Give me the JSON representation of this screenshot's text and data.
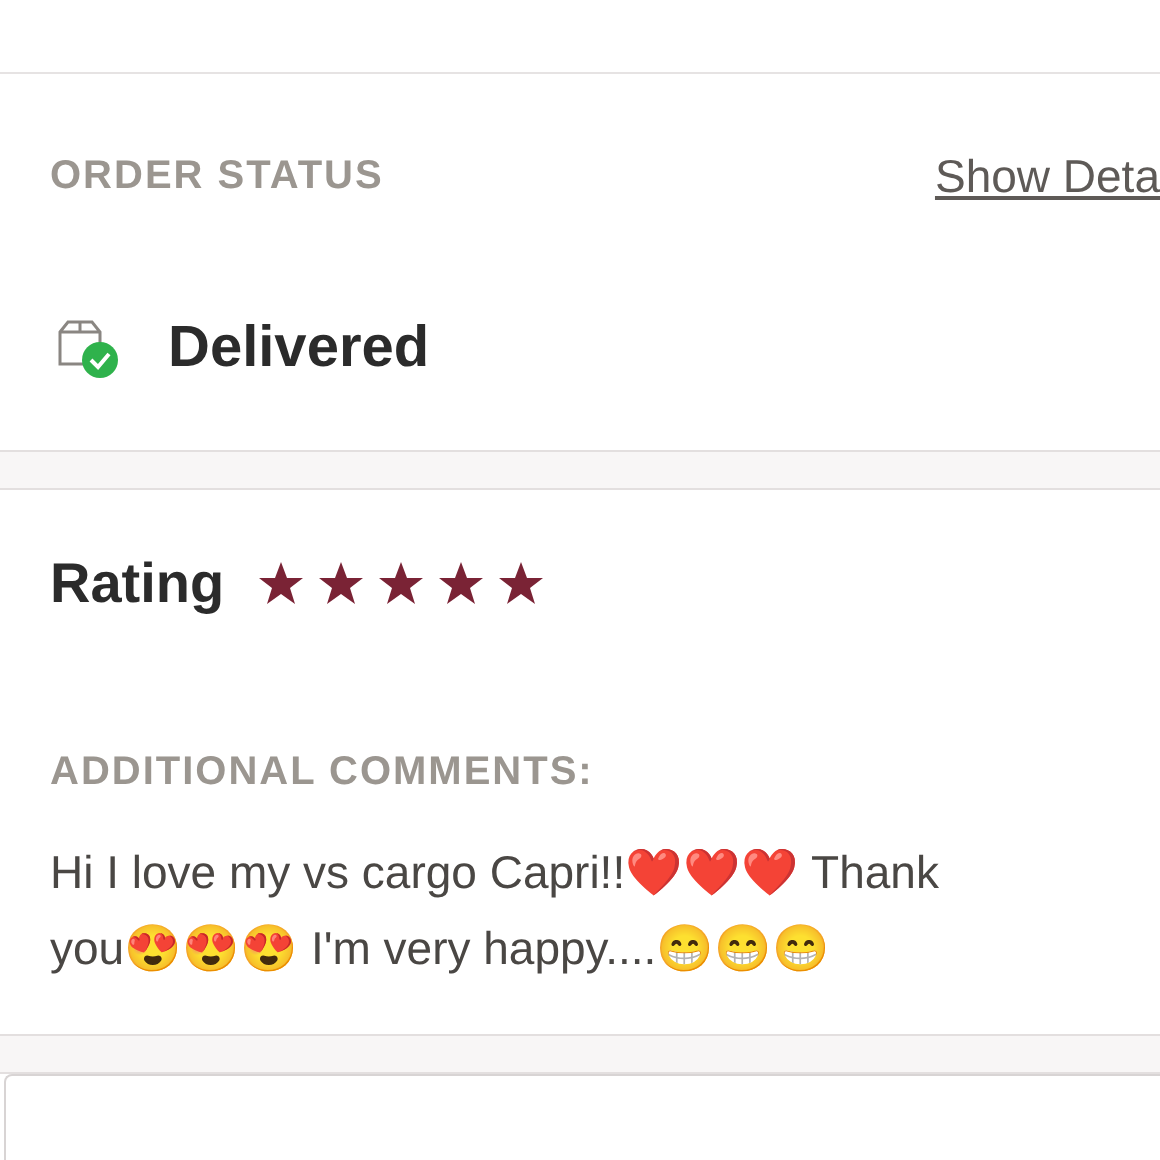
{
  "order_status": {
    "heading": "ORDER STATUS",
    "link": "Show Deta",
    "status": "Delivered"
  },
  "rating": {
    "label": "Rating",
    "stars": 5
  },
  "comments": {
    "heading": "ADDITIONAL COMMENTS:",
    "text": "Hi I love my vs cargo Capri!!❤️❤️❤️ Thank you😍😍😍 I'm very happy....😁😁😁"
  }
}
